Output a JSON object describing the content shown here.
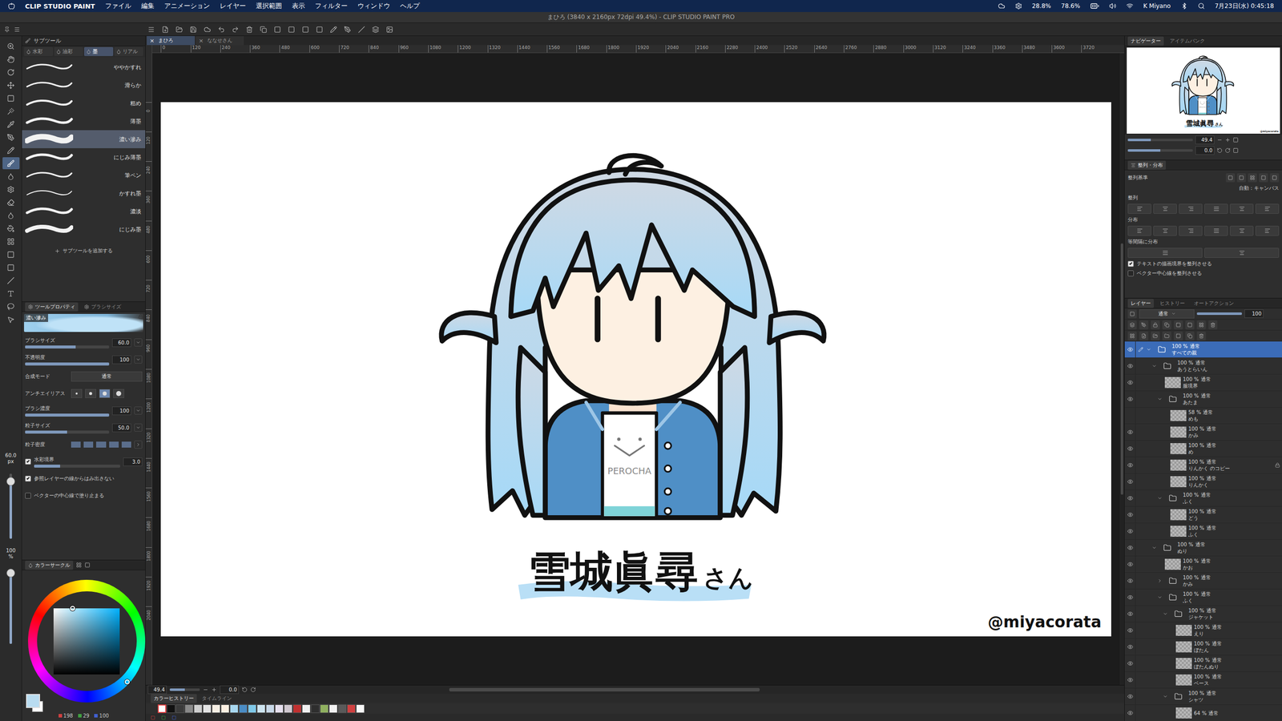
{
  "menubar": {
    "app": "CLIP STUDIO PAINT",
    "items": [
      "ファイル",
      "編集",
      "アニメーション",
      "レイヤー",
      "選択範囲",
      "表示",
      "フィルター",
      "ウィンドウ",
      "ヘルプ"
    ],
    "readings": [
      "28.8%",
      "78.6%"
    ],
    "user": "K Miyano",
    "clock": "7月23日(水) 0:45:18"
  },
  "window": {
    "title": "まひろ (3840 x 2160px 72dpi 49.4%) - CLIP STUDIO PAINT PRO"
  },
  "tools": [
    {
      "selected": false
    },
    {
      "selected": false
    },
    {
      "selected": false
    },
    {
      "selected": false
    },
    {
      "selected": false
    },
    {
      "selected": false
    },
    {
      "selected": false
    },
    {
      "selected": false
    },
    {
      "selected": false
    },
    {
      "selected": true
    },
    {
      "selected": false
    },
    {
      "selected": false
    },
    {
      "selected": false
    },
    {
      "selected": false
    },
    {
      "selected": false
    },
    {
      "selected": false
    },
    {
      "selected": false
    },
    {
      "selected": false
    },
    {
      "selected": false
    },
    {
      "selected": false
    },
    {
      "selected": false
    },
    {
      "selected": false
    }
  ],
  "brush_size_indicator": {
    "value": "60.0",
    "unit": "px",
    "level": 0.95
  },
  "opacity_indicator": {
    "value": "100",
    "unit": "%",
    "level": 1
  },
  "subtool": {
    "title": "サブツール",
    "tabs": [
      {
        "label": "水彩",
        "selected": false
      },
      {
        "label": "油彩",
        "selected": false
      },
      {
        "label": "墨",
        "selected": true
      },
      {
        "label": "リアル",
        "selected": false
      }
    ],
    "brushes": [
      {
        "name": "ややかすれ",
        "selected": false
      },
      {
        "name": "滑らか",
        "selected": false
      },
      {
        "name": "粗め",
        "selected": false
      },
      {
        "name": "薄墨",
        "selected": false
      },
      {
        "name": "濃い滲み",
        "selected": true
      },
      {
        "name": "にじみ薄墨",
        "selected": false
      },
      {
        "name": "筆ペン",
        "selected": false
      },
      {
        "name": "かすれ墨",
        "selected": false
      },
      {
        "name": "濃淡",
        "selected": false
      },
      {
        "name": "にじみ墨",
        "selected": false
      }
    ],
    "add": "サブツールを追加する"
  },
  "tool_property": {
    "tabs": [
      {
        "label": "ツールプロパティ",
        "selected": true
      },
      {
        "label": "ブラシサイズ",
        "selected": false
      }
    ],
    "brush": "濃い滲み",
    "rows": [
      {
        "kind": "slider",
        "label": "ブラシサイズ",
        "value": "60.0",
        "level": 0.6
      },
      {
        "kind": "slider",
        "label": "不透明度",
        "value": "100",
        "level": 1
      },
      {
        "kind": "select",
        "label": "合成モード",
        "value": "通常"
      },
      {
        "kind": "choice",
        "label": "アンチエイリアス",
        "options": [
          {
            "selected": false
          },
          {
            "selected": false
          },
          {
            "selected": true
          },
          {
            "selected": false
          }
        ]
      },
      {
        "kind": "slider",
        "label": "ブラシ濃度",
        "value": "100",
        "level": 1
      },
      {
        "kind": "slider",
        "label": "粒子サイズ",
        "value": "50.0",
        "level": 0.5
      },
      {
        "kind": "steps",
        "label": "粒子密度",
        "steps": [
          {
            "on": true
          },
          {
            "on": true
          },
          {
            "on": true
          },
          {
            "on": true
          },
          {
            "on": true
          }
        ]
      },
      {
        "kind": "check-slider",
        "label": "水彩境界",
        "checked": true,
        "value": "3.0",
        "level": 0.3
      },
      {
        "kind": "check",
        "label": "参照レイヤーの線からはみ出さない",
        "checked": true
      },
      {
        "kind": "check",
        "label": "ベクターの中心線で塗り止まる",
        "checked": false
      }
    ]
  },
  "color": {
    "title": "カラーサークル",
    "hsv": [
      "198",
      "29",
      "100"
    ]
  },
  "documents": {
    "close": "×",
    "tabs": [
      {
        "label": "まひろ",
        "selected": true
      },
      {
        "label": "ななせさん",
        "selected": false
      }
    ]
  },
  "ruler": {
    "ticks": [
      "0",
      "120",
      "240",
      "360",
      "480",
      "600",
      "720",
      "840",
      "960",
      "1080",
      "1200",
      "1320",
      "1440",
      "1560",
      "1680",
      "1800",
      "1920",
      "2040",
      "2160",
      "2280",
      "2400",
      "2520",
      "2640",
      "2760",
      "2880",
      "3000",
      "3120",
      "3240",
      "3360",
      "3480",
      "3600",
      "3720"
    ],
    "vticks": [
      "0",
      "120",
      "240",
      "360",
      "480",
      "600",
      "720",
      "840",
      "960",
      "1080",
      "1200",
      "1320",
      "1440",
      "1560",
      "1680",
      "1800",
      "1920",
      "2040"
    ]
  },
  "canvas": {
    "caption": "雪城眞尋",
    "suffix": "さん",
    "credit": "@miyacorata",
    "shirt": "PEROCHA"
  },
  "statusbar": {
    "zoom": "49.4",
    "rotation": "0.0",
    "zoom_level": 0.5
  },
  "color_history": {
    "tabs": [
      {
        "label": "カラーヒストリー",
        "selected": true
      },
      {
        "label": "タイムライン",
        "selected": false
      }
    ],
    "swatches": [
      {
        "color": "#ffffff",
        "selected": true
      },
      {
        "color": "#111111",
        "selected": false
      },
      {
        "color": "#3a3a3a",
        "selected": false
      },
      {
        "color": "#8a8a8a",
        "selected": false
      },
      {
        "color": "#cfcfcf",
        "selected": false
      },
      {
        "color": "#e4e4e4",
        "selected": false
      },
      {
        "color": "#f6efe4",
        "selected": false
      },
      {
        "color": "#fdf0e2",
        "selected": false
      },
      {
        "color": "#a8d8f0",
        "selected": false
      },
      {
        "color": "#4a8cc4",
        "selected": false
      },
      {
        "color": "#7fc8e8",
        "selected": false
      },
      {
        "color": "#cde4f0",
        "selected": false
      },
      {
        "color": "#c8d8e8",
        "selected": false
      },
      {
        "color": "#e6e0ee",
        "selected": false
      },
      {
        "color": "#d0c8d0",
        "selected": false
      },
      {
        "color": "#c03030",
        "selected": false
      },
      {
        "color": "#f0f0f0",
        "selected": false
      },
      {
        "color": "#2e2e2e",
        "selected": false
      },
      {
        "color": "#90b060",
        "selected": false
      },
      {
        "color": "#f2f2f2",
        "selected": false
      },
      {
        "color": "#5a5a5a",
        "selected": false
      },
      {
        "color": "#d04040",
        "selected": false
      },
      {
        "color": "#f8f8f8",
        "selected": false
      }
    ]
  },
  "navigator": {
    "tabs": [
      {
        "label": "ナビゲーター",
        "selected": true
      },
      {
        "label": "アイテムバンク",
        "selected": false
      }
    ],
    "zoom": "49.4",
    "zoom_level": 0.35,
    "rotation": "0.0",
    "rotation_level": 0.5
  },
  "align": {
    "title": "整列・分布",
    "basis_label": "整列基準",
    "basis": "自動：キャンバス",
    "sections": [
      "整列",
      "分布",
      "等間隔に分布"
    ],
    "checks": [
      {
        "label": "テキストの描画境界を整列させる",
        "checked": true
      },
      {
        "label": "ベクター中心線を整列させる",
        "checked": false
      }
    ]
  },
  "layers": {
    "tabs": [
      {
        "label": "レイヤー",
        "selected": true
      },
      {
        "label": "ヒストリー",
        "selected": false
      },
      {
        "label": "オートアクション",
        "selected": false
      }
    ],
    "blend": "通常",
    "opacity": "100",
    "opacity_level": 1,
    "items": [
      {
        "depth": 0,
        "kind": "folder",
        "opacity": "100 %",
        "blend": "通常",
        "name": "すべての親",
        "expanded": true,
        "selected": true,
        "visible": true,
        "locked": false
      },
      {
        "depth": 1,
        "kind": "folder",
        "opacity": "100 %",
        "blend": "通常",
        "name": "あうとらいん",
        "expanded": true,
        "selected": false,
        "visible": true,
        "locked": false
      },
      {
        "depth": 2,
        "kind": "layer",
        "opacity": "100 %",
        "blend": "通常",
        "name": "服境界",
        "selected": false,
        "visible": true,
        "locked": false
      },
      {
        "depth": 2,
        "kind": "folder",
        "opacity": "100 %",
        "blend": "通常",
        "name": "あたま",
        "expanded": true,
        "selected": false,
        "visible": true,
        "locked": false
      },
      {
        "depth": 3,
        "kind": "layer",
        "opacity": "58 %",
        "blend": "通常",
        "name": "めも",
        "selected": false,
        "visible": false,
        "locked": false
      },
      {
        "depth": 3,
        "kind": "layer",
        "opacity": "100 %",
        "blend": "通常",
        "name": "かみ",
        "selected": false,
        "visible": true,
        "locked": false
      },
      {
        "depth": 3,
        "kind": "layer",
        "opacity": "100 %",
        "blend": "通常",
        "name": "め",
        "selected": false,
        "visible": true,
        "locked": false
      },
      {
        "depth": 3,
        "kind": "layer",
        "opacity": "100 %",
        "blend": "通常",
        "name": "りんかく のコピー",
        "selected": false,
        "visible": true,
        "locked": true
      },
      {
        "depth": 3,
        "kind": "layer",
        "opacity": "100 %",
        "blend": "通常",
        "name": "りんかく",
        "selected": false,
        "visible": true,
        "locked": false
      },
      {
        "depth": 2,
        "kind": "folder",
        "opacity": "100 %",
        "blend": "通常",
        "name": "ふく",
        "expanded": true,
        "selected": false,
        "visible": true,
        "locked": false
      },
      {
        "depth": 3,
        "kind": "layer",
        "opacity": "100 %",
        "blend": "通常",
        "name": "どう",
        "selected": false,
        "visible": true,
        "locked": false
      },
      {
        "depth": 3,
        "kind": "layer",
        "opacity": "100 %",
        "blend": "通常",
        "name": "ふく",
        "selected": false,
        "visible": true,
        "locked": false
      },
      {
        "depth": 1,
        "kind": "folder",
        "opacity": "100 %",
        "blend": "通常",
        "name": "ぬり",
        "expanded": true,
        "selected": false,
        "visible": true,
        "locked": false
      },
      {
        "depth": 2,
        "kind": "layer",
        "opacity": "100 %",
        "blend": "通常",
        "name": "かお",
        "selected": false,
        "visible": true,
        "locked": false
      },
      {
        "depth": 2,
        "kind": "folder",
        "opacity": "100 %",
        "blend": "通常",
        "name": "かみ",
        "expanded": false,
        "selected": false,
        "visible": true,
        "locked": false
      },
      {
        "depth": 2,
        "kind": "folder",
        "opacity": "100 %",
        "blend": "通常",
        "name": "ふく",
        "expanded": true,
        "selected": false,
        "visible": true,
        "locked": false
      },
      {
        "depth": 3,
        "kind": "folder",
        "opacity": "100 %",
        "blend": "通常",
        "name": "ジャケット",
        "expanded": true,
        "selected": false,
        "visible": true,
        "locked": false
      },
      {
        "depth": 4,
        "kind": "layer",
        "opacity": "100 %",
        "blend": "通常",
        "name": "えり",
        "selected": false,
        "visible": true,
        "locked": false
      },
      {
        "depth": 4,
        "kind": "layer",
        "opacity": "100 %",
        "blend": "通常",
        "name": "ぼたん",
        "selected": false,
        "visible": true,
        "locked": false
      },
      {
        "depth": 4,
        "kind": "layer",
        "opacity": "100 %",
        "blend": "通常",
        "name": "ぼたんぬり",
        "selected": false,
        "visible": true,
        "locked": false
      },
      {
        "depth": 4,
        "kind": "layer",
        "opacity": "100 %",
        "blend": "通常",
        "name": "ベース",
        "selected": false,
        "visible": true,
        "locked": false
      },
      {
        "depth": 3,
        "kind": "folder",
        "opacity": "100 %",
        "blend": "通常",
        "name": "シャツ",
        "expanded": true,
        "selected": false,
        "visible": true,
        "locked": false
      },
      {
        "depth": 4,
        "kind": "layer",
        "opacity": "64 %",
        "blend": "通常",
        "selected": false,
        "visible": true,
        "locked": false
      }
    ]
  }
}
